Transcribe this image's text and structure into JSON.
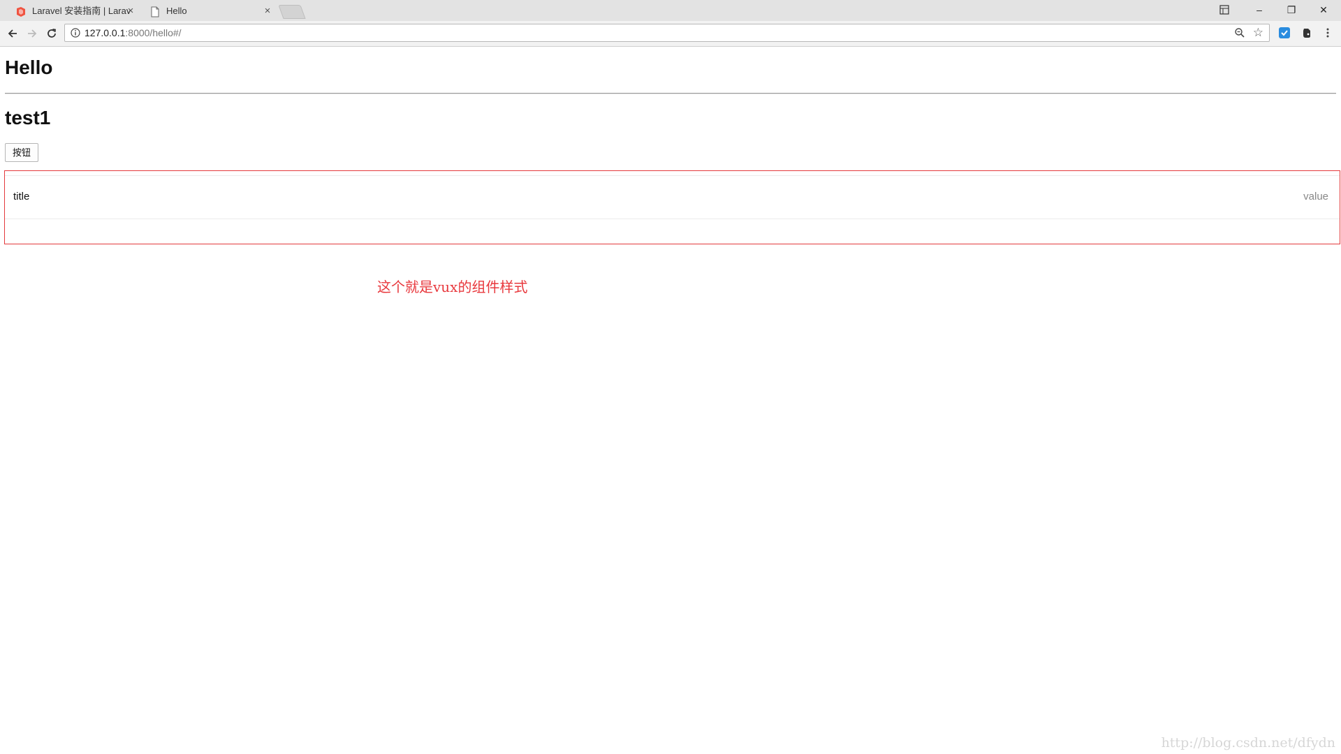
{
  "browser": {
    "tabs": [
      {
        "label": "Laravel 安装指南 | Larav",
        "active": false,
        "favicon": "laravel-icon"
      },
      {
        "label": "Hello",
        "active": true,
        "favicon": "page-icon"
      }
    ],
    "close_glyph": "×",
    "window_controls": {
      "minimize": "–",
      "restore": "❐",
      "close": "✕"
    },
    "address": {
      "host": "127.0.0.1",
      "path": ":8000/hello#/"
    },
    "bookmark_glyph": "☆",
    "colors": {
      "accent": "#e4393c",
      "annotation": "#e8383d",
      "laravel_red": "#f05340",
      "extension_blue": "#2a8cdf"
    }
  },
  "page": {
    "heading": "Hello",
    "subheading": "test1",
    "button_label": "按钮",
    "cell": {
      "title": "title",
      "value": "value"
    },
    "annotation": "这个就是vux的组件样式",
    "watermark": "http://blog.csdn.net/dfydn"
  }
}
